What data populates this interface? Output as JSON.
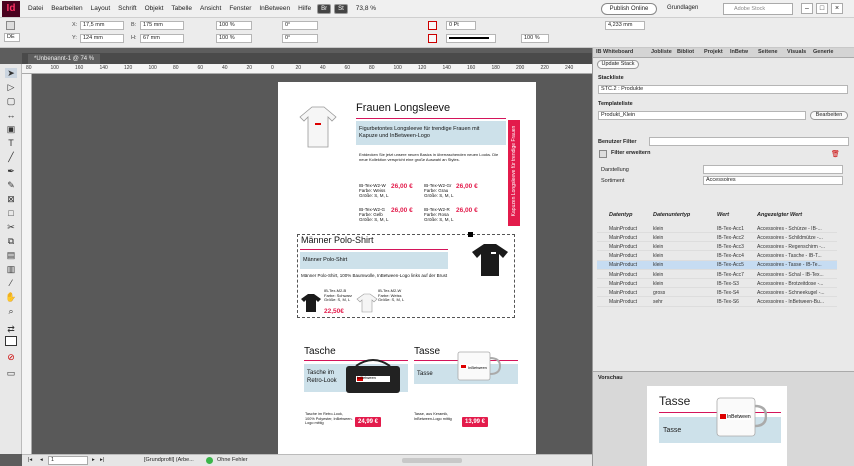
{
  "app": {
    "logo": "Id"
  },
  "menu": [
    "Datei",
    "Bearbeiten",
    "Layout",
    "Schrift",
    "Objekt",
    "Tabelle",
    "Ansicht",
    "Fenster",
    "InBetween",
    "Hilfe"
  ],
  "menubar": {
    "br_label": "Br",
    "st_label": "St",
    "zoom": "73,8 %",
    "publish": "Publish Online",
    "workspace": "Grundlagen",
    "stock_search": "Adobe Stock"
  },
  "control": {
    "x": "17,5 mm",
    "y": "124 mm",
    "b": "175 mm",
    "h": "67 mm",
    "scale1": "100 %",
    "scale2": "100 %",
    "angle1": "0°",
    "angle2": "0°",
    "stroke": "0 Pt",
    "width": "4,233 mm",
    "pct": "100 %",
    "ref": "DE"
  },
  "tab": {
    "doc": "*Unbenannt-1 @ 74 %"
  },
  "ruler": [
    "80",
    "100",
    "160",
    "140",
    "120",
    "100",
    "80",
    "60",
    "40",
    "20",
    "0",
    "20",
    "40",
    "60",
    "80",
    "100",
    "120",
    "140",
    "160",
    "180",
    "200",
    "220",
    "240"
  ],
  "page": {
    "longsleeve": {
      "title": "Frauen Longsleeve",
      "band": "Figurbetontes Longsleeve für trendige Frauen mit Kapuze und InBetween-Logo",
      "desc": "Entdecken Sie jetzt unsere neuen Basics in überraschenden neuen Looks. Die neue Kollektion verspricht eine große Auswahl an Styles.",
      "vertical": "Kapuzen Longsleeve für trendige Frauen",
      "items": [
        {
          "id": "IB-Tex-W2-W",
          "d1": "Farbe: Weiss",
          "d2": "Größe: S, M, L",
          "price": "26,00 €"
        },
        {
          "id": "IB-Tex-W2-Gr",
          "d1": "Farbe: Grau",
          "d2": "Größe: S, M, L",
          "price": "26,00 €"
        },
        {
          "id": "IB-Tex-W2-G",
          "d1": "Farbe: Gelb",
          "d2": "Größe: S, M, L",
          "price": "26,00 €"
        },
        {
          "id": "IB-Tex-W2-R",
          "d1": "Farbe: Rosa",
          "d2": "Größe: S, M, L",
          "price": "26,00 €"
        }
      ]
    },
    "polo": {
      "title": "Männer Polo-Shirt",
      "band": "Männer Polo-Shirt",
      "desc": "Männer Polo-Shirt, 100% Baumwolle, InBetween-Logo links auf der Brust",
      "items": [
        {
          "id": "IB-Tex-M2-B",
          "d1": "Farbe: Schwarz",
          "d2": "Größe: S, M, L"
        },
        {
          "id": "IB-Tex-M2-W",
          "d1": "Farbe: Weiss",
          "d2": "Größe: S, M, L"
        }
      ],
      "price": "22,50€"
    },
    "bag": {
      "title": "Tasche",
      "band": "Tasche im Retro-Look",
      "desc": "Tasche im Retro-Look, 100% Polyester, InBetween-Logo mittig",
      "price": "24,99 €"
    },
    "mug": {
      "title": "Tasse",
      "band": "Tasse",
      "desc": "Tasse, aus Keramik, InBetween-Logo mittig",
      "price": "13,99 €"
    },
    "logo": "InBetween"
  },
  "status": {
    "page": "1",
    "profile": "[Grundprofil] (Arbe...",
    "errors": "Ohne Fehler"
  },
  "panel": {
    "tabs": [
      "IB Whiteboard",
      "Jobliste",
      "Bibliot",
      "Projekt",
      "InBetw",
      "Seitene",
      "Visuals",
      "Generie"
    ],
    "update_btn": "Update Stack",
    "stackliste_label": "Stackliste",
    "stackliste_value": "STC.2 : Produkte",
    "templateliste_label": "Templateliste",
    "templateliste_value": "Produkt_Klein",
    "edit_btn": "Bearbeiten",
    "filter_label": "Benutzer Filter",
    "filter_ext": "Filter erweitern",
    "darstellung_label": "Darstellung",
    "sortiment_label": "Sortiment",
    "sortiment_value": "Accessoires",
    "headers": [
      "Datentyp",
      "Datenuntertyp",
      "Wert",
      "Angezeigter Wert"
    ],
    "rows": [
      [
        "MainProduct",
        "klein",
        "IB-Tex-Acc1",
        "Accessoires - Schürze - IB-..."
      ],
      [
        "MainProduct",
        "klein",
        "IB-Tex-Acc2",
        "Accessoires - Schildmütze -..."
      ],
      [
        "MainProduct",
        "klein",
        "IB-Tex-Acc3",
        "Accessoires - Regenschirm -..."
      ],
      [
        "MainProduct",
        "klein",
        "IB-Tex-Acc4",
        "Accessoires - Tasche - IB-T..."
      ],
      [
        "MainProduct",
        "klein",
        "IB-Tex-Acc5",
        "Accessoires - Tasse - IB-Te..."
      ],
      [
        "MainProduct",
        "klein",
        "IB-Tex-Acc7",
        "Accessoires - Schal - IB-Tex..."
      ],
      [
        "MainProduct",
        "klein",
        "IB-Tex-S3",
        "Accessoires - Brotzeitdose -..."
      ],
      [
        "MainProduct",
        "gross",
        "IB-Tex-S4",
        "Accessoires - Schneekugel -..."
      ],
      [
        "MainProduct",
        "sehr",
        "IB-Tex-S6",
        "Accessoires - InBetween-Bu..."
      ]
    ],
    "preview_label": "Vorschau",
    "preview_title": "Tasse",
    "preview_band": "Tasse"
  },
  "colors": {
    "accent": "#e31b4b",
    "band": "#cde1ea",
    "selected_row": "#c6dcf2"
  }
}
